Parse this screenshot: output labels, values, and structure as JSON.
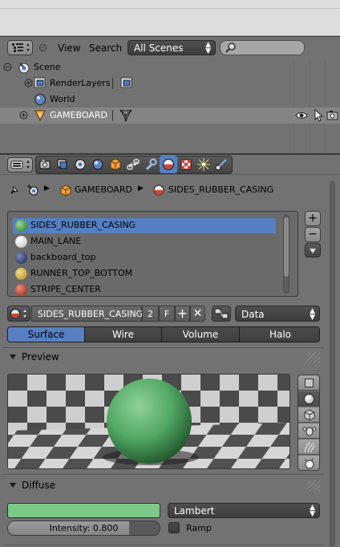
{
  "outliner": {
    "view_label": "View",
    "search_label": "Search",
    "scene_select": "All Scenes",
    "search_placeholder": "",
    "tree": [
      {
        "label": "Scene",
        "icon": "scene-icon"
      },
      {
        "label": "RenderLayers",
        "icon": "render-layers-icon"
      },
      {
        "label": "World",
        "icon": "world-icon"
      },
      {
        "label": "GAMEBOARD",
        "icon": "mesh-object-icon"
      }
    ]
  },
  "properties": {
    "breadcrumb": {
      "object": "GAMEBOARD",
      "material": "SIDES_RUBBER_CASING"
    },
    "material_slots": [
      {
        "name": "SIDES_RUBBER_CASING",
        "color": "#4e9e4e"
      },
      {
        "name": "MAIN_LANE",
        "color": "#d8d8d8"
      },
      {
        "name": "backboard_top",
        "color": "#3b4a7a"
      },
      {
        "name": "RUNNER_TOP_BOTTOM",
        "color": "#c8a84a"
      },
      {
        "name": "STRIPE_CENTER",
        "color": "#b84a3c"
      }
    ],
    "material_name": "SIDES_RUBBER_CASING",
    "users_count": "2",
    "fake_user": "F",
    "link_select": "Data",
    "type_tabs": [
      "Surface",
      "Wire",
      "Volume",
      "Halo"
    ],
    "active_type_tab": "Surface",
    "preview_title": "Preview",
    "diffuse_title": "Diffuse",
    "diffuse_color": "#7dc98a",
    "diffuse_shader": "Lambert",
    "intensity_label": "Intensity: 0.800",
    "intensity_value": 0.8,
    "ramp_label": "Ramp",
    "selected_slot": "SIDES_RUBBER_CASING",
    "accent_color": "#5680c2"
  }
}
